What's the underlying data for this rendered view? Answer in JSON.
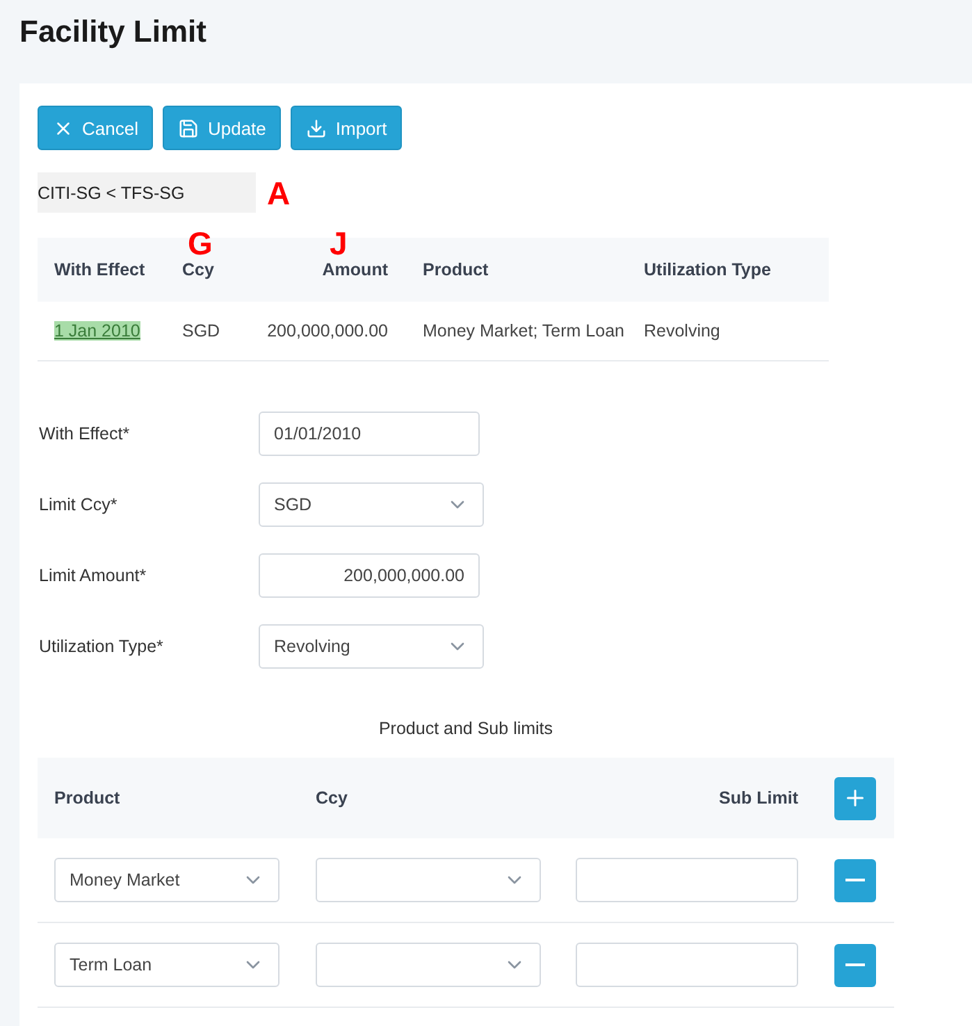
{
  "page_title": "Facility Limit",
  "toolbar": [
    {
      "label": "Cancel",
      "kind": "cancel"
    },
    {
      "label": "Update",
      "kind": "save"
    },
    {
      "label": "Import",
      "kind": "import"
    }
  ],
  "breadcrumb": "CITI-SG < TFS-SG",
  "annotations": [
    "A",
    "G",
    "J"
  ],
  "summary_table": {
    "columns": [
      "With Effect",
      "Ccy",
      "Amount",
      "Product",
      "Utilization Type"
    ],
    "rows": [
      {
        "with_effect": "1 Jan 2010",
        "highlighted": true,
        "ccy": "SGD",
        "amount": "200,000,000.00",
        "product": "Money Market; Term Loan",
        "utilization_type": "Revolving"
      }
    ]
  },
  "form": [
    {
      "label": "With Effect*",
      "kind": "text",
      "value": "01/01/2010"
    },
    {
      "label": "Limit Ccy*",
      "kind": "select",
      "value": "SGD"
    },
    {
      "label": "Limit Amount*",
      "kind": "amount",
      "value": "200,000,000.00"
    },
    {
      "label": "Utilization Type*",
      "kind": "select",
      "value": "Revolving"
    }
  ],
  "sub_limits": {
    "title": "Product and Sub limits",
    "columns": [
      "Product",
      "Ccy",
      "Sub Limit"
    ],
    "rows": [
      {
        "product": "Money Market"
      },
      {
        "product": "Term Loan"
      }
    ]
  }
}
